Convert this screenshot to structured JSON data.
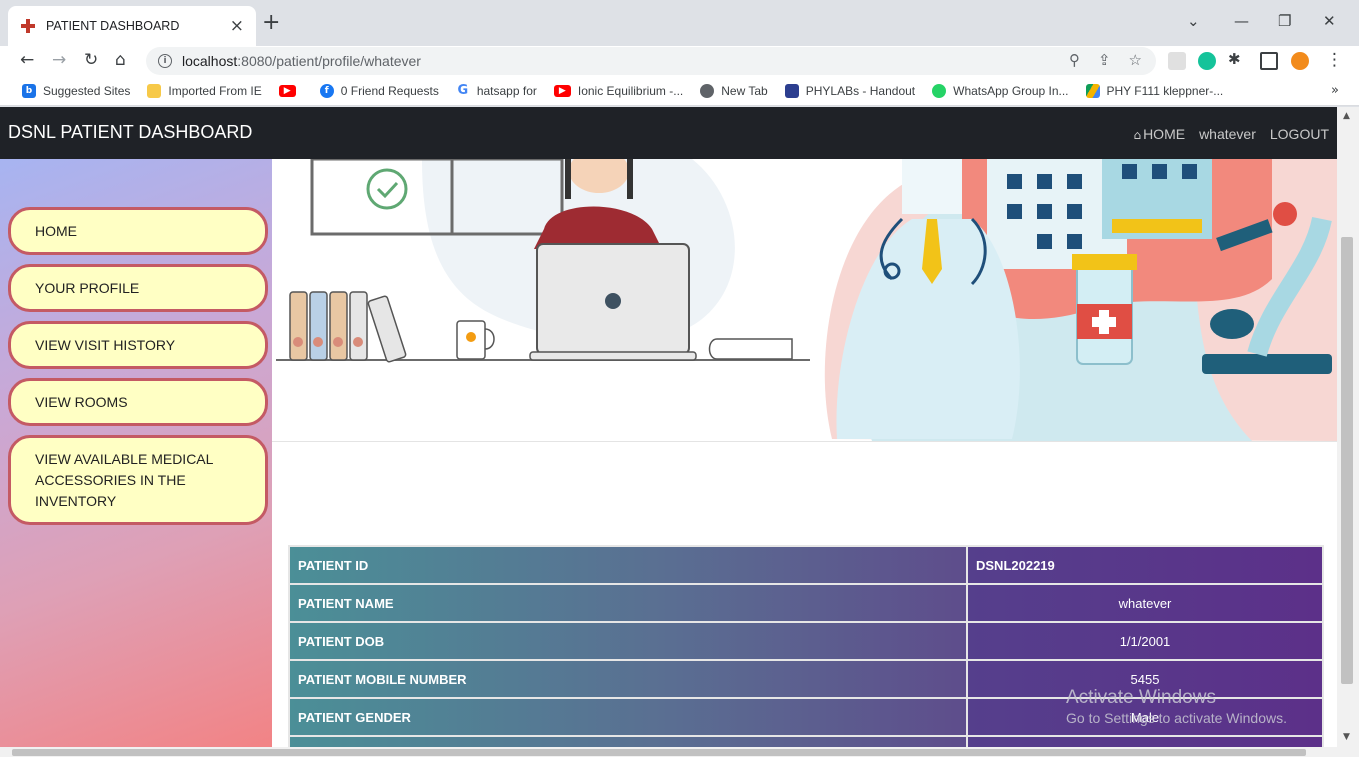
{
  "browser": {
    "tab_title": "PATIENT DASHBOARD",
    "tab_close": "×",
    "new_tab": "+",
    "url_host": "localhost",
    "url_path": ":8080/patient/profile/whatever",
    "window_controls": [
      "⌄",
      "—",
      "❐",
      "✕"
    ],
    "bookmarks": [
      {
        "label": "Suggested Sites",
        "icon": "bing-icon",
        "color": "#1a73e8"
      },
      {
        "label": "Imported From IE",
        "icon": "folder-icon",
        "color": "#f7c948"
      },
      {
        "label": "",
        "icon": "youtube-icon",
        "color": "#ff0000"
      },
      {
        "label": "0 Friend Requests",
        "icon": "facebook-icon",
        "color": "#1877f2"
      },
      {
        "label": "hatsapp for",
        "icon": "google-icon",
        "color": "#4285f4"
      },
      {
        "label": "Ionic Equilibrium -...",
        "icon": "youtube-icon",
        "color": "#ff0000"
      },
      {
        "label": "New Tab",
        "icon": "globe-icon",
        "color": "#5f6368"
      },
      {
        "label": "PHYLABs - Handout",
        "icon": "phylab-icon",
        "color": "#2c3e8f"
      },
      {
        "label": "WhatsApp Group In...",
        "icon": "whatsapp-icon",
        "color": "#25d366"
      },
      {
        "label": "PHY F111 kleppner-...",
        "icon": "drive-icon",
        "color": "#f4b400"
      }
    ],
    "bookmarks_more": "»"
  },
  "navbar": {
    "brand": "DSNL PATIENT DASHBOARD",
    "home": "HOME",
    "user": "whatever",
    "logout": "LOGOUT"
  },
  "sidebar": {
    "items": [
      {
        "label": "HOME"
      },
      {
        "label": "YOUR PROFILE"
      },
      {
        "label": "VIEW VISIT HISTORY"
      },
      {
        "label": "VIEW ROOMS"
      },
      {
        "label": "VIEW AVAILABLE MEDICAL ACCESSORIES IN THE INVENTORY"
      }
    ]
  },
  "profile": {
    "rows": [
      {
        "label": "PATIENT ID",
        "value": "DSNL202219"
      },
      {
        "label": "PATIENT NAME",
        "value": "whatever"
      },
      {
        "label": "PATIENT DOB",
        "value": "1/1/2001"
      },
      {
        "label": "PATIENT MOBILE NUMBER",
        "value": "5455"
      },
      {
        "label": "PATIENT GENDER",
        "value": "Male"
      },
      {
        "label": "",
        "value": ""
      }
    ]
  },
  "watermark": {
    "line1": "Activate Windows",
    "line2": "Go to Settings to activate Windows."
  },
  "colors": {
    "navbar": "#1f2227",
    "sidebar_button": "#ffffc4",
    "sidebar_border": "#c45a64",
    "table_label": "#4b8f97",
    "table_value": "#5c3089"
  }
}
